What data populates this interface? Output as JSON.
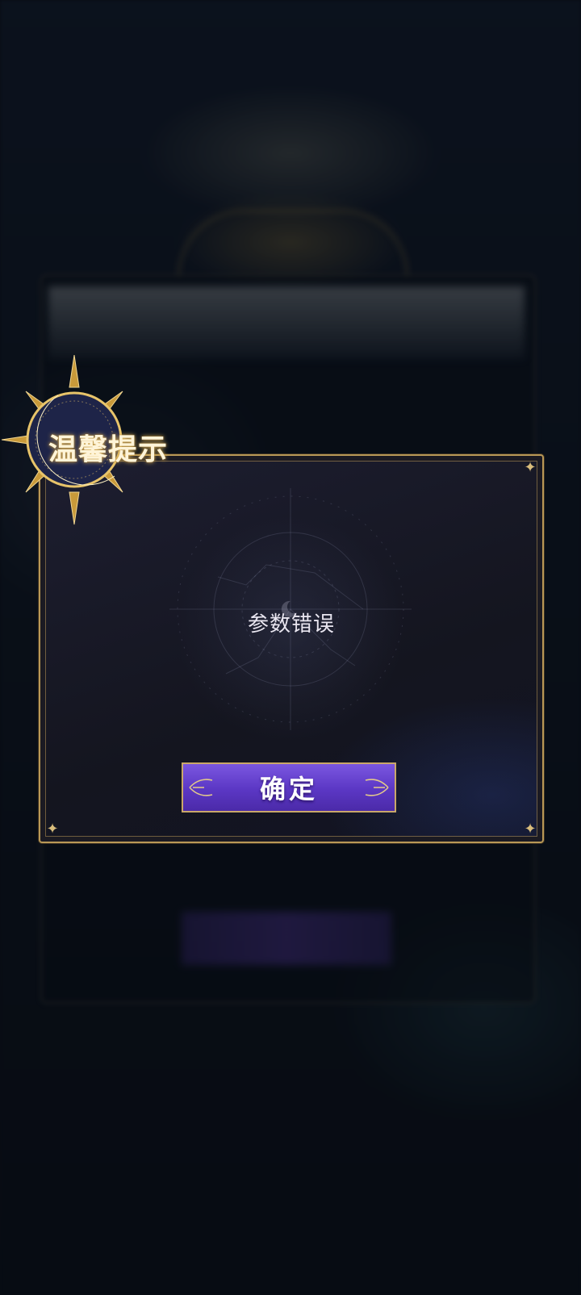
{
  "dialog": {
    "title": "温馨提示",
    "message": "参数错误",
    "confirm_label": "确定"
  },
  "icons": {
    "emblem": "crescent-moon-sun-emblem-icon",
    "corner": "star-corner-icon"
  },
  "colors": {
    "gold": "#b99856",
    "button_purple": "#5b37c4",
    "panel_dark": "#14151f"
  }
}
